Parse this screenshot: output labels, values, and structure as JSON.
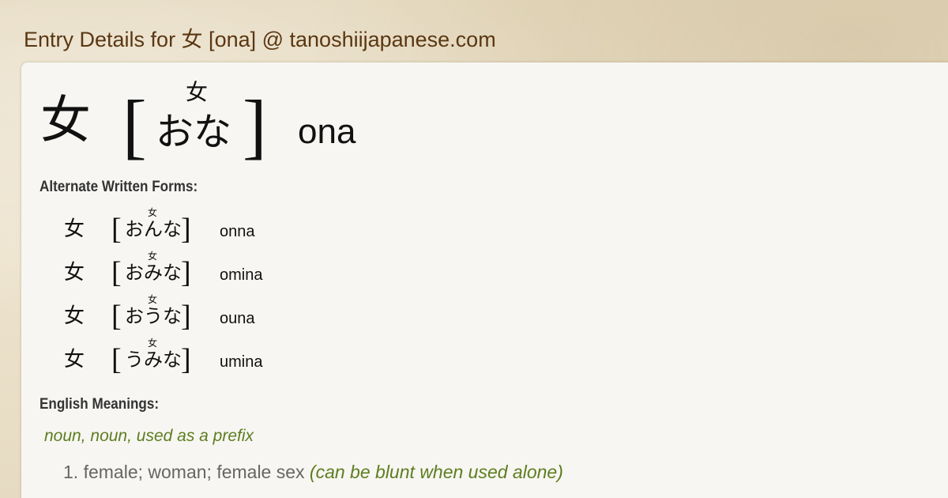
{
  "header": {
    "title": "Entry Details for 女 [ona] @ tanoshiijapanese.com"
  },
  "entry": {
    "kanji": "女",
    "furigana": "女",
    "kana": "おな",
    "bracket_open": "[",
    "bracket_close": "]",
    "romaji": "ona"
  },
  "alternate_forms": {
    "heading": "Alternate Written Forms:",
    "items": [
      {
        "kanji": "女",
        "furigana": "女",
        "kana": "おんな",
        "romaji": "onna"
      },
      {
        "kanji": "女",
        "furigana": "女",
        "kana": "おみな",
        "romaji": "omina"
      },
      {
        "kanji": "女",
        "furigana": "女",
        "kana": "おうな",
        "romaji": "ouna"
      },
      {
        "kanji": "女",
        "furigana": "女",
        "kana": "うみな",
        "romaji": "umina"
      }
    ]
  },
  "meanings": {
    "heading": "English Meanings:",
    "part_of_speech": "noun, noun, used as a prefix",
    "items": [
      {
        "number": "1.",
        "text": "female; woman; female sex",
        "note": "(can be blunt when used alone)"
      }
    ]
  },
  "colors": {
    "header_text": "#5a3712",
    "accent_green": "#5d7d20",
    "card_bg": "#f7f6f2",
    "meaning_gray": "#666666"
  }
}
